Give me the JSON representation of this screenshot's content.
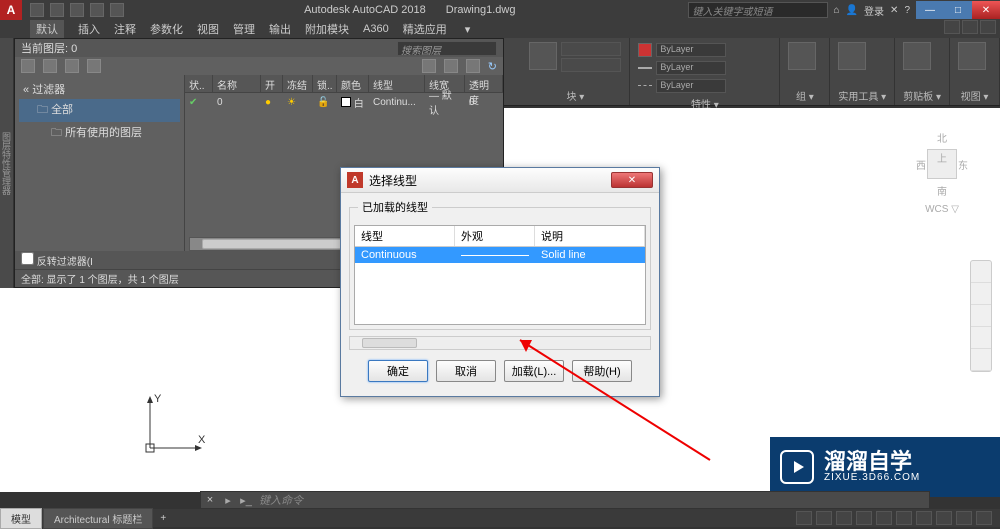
{
  "titlebar": {
    "app_name": "Autodesk AutoCAD 2018",
    "doc_name": "Drawing1.dwg",
    "search_placeholder": "键入关键字或短语",
    "login_label": "登录"
  },
  "menubar": {
    "items": [
      "默认",
      "插入",
      "注释",
      "参数化",
      "视图",
      "管理",
      "输出",
      "附加模块",
      "A360",
      "精选应用"
    ]
  },
  "ribbon": {
    "panels": [
      {
        "title": "块"
      },
      {
        "title": "特性",
        "bylayer": "ByLayer"
      },
      {
        "title": "组"
      },
      {
        "title": "实用工具"
      },
      {
        "title": "剪贴板"
      },
      {
        "title": "视图"
      }
    ]
  },
  "layer_panel": {
    "current_layer_label": "当前图层: 0",
    "search_placeholder": "搜索图层",
    "filter_label": "过滤器",
    "tree": {
      "all": "全部",
      "used": "所有使用的图层"
    },
    "columns": [
      "状..",
      "名称",
      "开",
      "冻结",
      "锁..",
      "颜色",
      "线型",
      "线宽",
      "透明度"
    ],
    "row": {
      "name": "0",
      "color_name": "白",
      "linetype": "Continu...",
      "lineweight": "— 默认",
      "transparency": "0"
    },
    "reverse_filter": "反转过滤器(I",
    "status": "全部: 显示了 1 个图层，共 1 个图层"
  },
  "dialog": {
    "title": "选择线型",
    "group_title": "已加载的线型",
    "columns": {
      "linetype": "线型",
      "appearance": "外观",
      "description": "说明"
    },
    "row": {
      "linetype": "Continuous",
      "description": "Solid line"
    },
    "buttons": {
      "ok": "确定",
      "cancel": "取消",
      "load": "加载(L)...",
      "help": "帮助(H)"
    }
  },
  "viewcube": {
    "north": "北",
    "west": "西",
    "top": "上",
    "east": "东",
    "south": "南",
    "wcs": "WCS ▽"
  },
  "cmdline": {
    "placeholder": "键入命令"
  },
  "tabs": {
    "model": "模型",
    "layout1": "Architectural 标题栏"
  },
  "watermark": {
    "brand": "溜溜自学",
    "url": "ZIXUE.3D66.COM"
  },
  "ucs": {
    "x": "X",
    "y": "Y"
  }
}
